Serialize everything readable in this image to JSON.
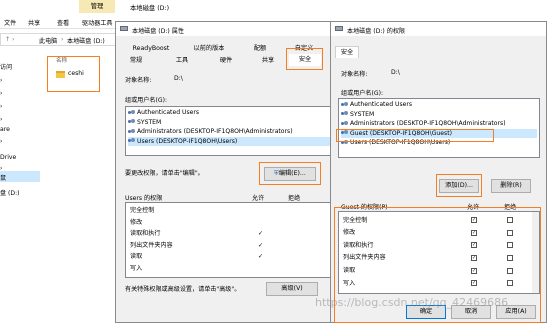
{
  "explorer": {
    "tab_manage": "管理",
    "title": "本地磁盘 (D:)",
    "menu": [
      "文件",
      "共享",
      "查看",
      "驱动器工具"
    ],
    "breadcrumb": [
      "此电脑",
      "本地磁盘 (D:)"
    ],
    "side_items": [
      "访问",
      "",
      "",
      "",
      "",
      "",
      "",
      "",
      "are",
      "",
      "Drive",
      "",
      "鼠",
      "盘 (D:)"
    ],
    "folder_header": "名称",
    "folder_name": "ceshi"
  },
  "props": {
    "title": "本地磁盘 (D:) 属性",
    "tabs_row1": [
      "ReadyBoost",
      "以前的版本",
      "配额",
      "自定义"
    ],
    "tabs_row2": [
      "常规",
      "工具",
      "硬件",
      "共享",
      "安全"
    ],
    "object_label": "对象名称:",
    "object_value": "D:\\",
    "group_label": "组或用户名(G):",
    "users": [
      "Authenticated Users",
      "SYSTEM",
      "Administrators (DESKTOP-IF1Q8OH\\Administrators)",
      "Users (DESKTOP-IF1Q8OH\\Users)"
    ],
    "change_hint": "要更改权限，请单击\"编辑\"。",
    "edit_button": "编辑(E)...",
    "perm_header": "Users 的权限",
    "allow": "允许",
    "deny": "拒绝",
    "perms": [
      "完全控制",
      "修改",
      "读取和执行",
      "列出文件夹内容",
      "读取",
      "写入"
    ],
    "allow_checks": [
      "",
      "",
      "✓",
      "✓",
      "✓",
      ""
    ],
    "adv_hint": "有关特殊权限或高级设置，请单击\"高级\"。",
    "adv_button": "高级(V)"
  },
  "perm": {
    "title": "本地磁盘 (D:) 的权限",
    "tab_security": "安全",
    "object_label": "对象名称:",
    "object_value": "D:\\",
    "group_label": "组或用户名(G):",
    "users": [
      "Authenticated Users",
      "SYSTEM",
      "Administrators (DESKTOP-IF1Q8OH\\Administrators)",
      "Guest (DESKTOP-IF1Q8OH\\Guest)",
      "Users (DESKTOP-IF1Q8OH\\Users)"
    ],
    "add_button": "添加(D)...",
    "remove_button": "删除(R)",
    "perm_header": "Guest 的权限(P)",
    "allow": "允许",
    "deny": "拒绝",
    "perms": [
      "完全控制",
      "修改",
      "读取和执行",
      "列出文件夹内容",
      "读取",
      "写入"
    ],
    "allow_checks": [
      "✓",
      "✓",
      "✓",
      "✓",
      "✓",
      "✓"
    ],
    "ok_button": "确定",
    "cancel_button": "取消",
    "apply_button": "应用(A)",
    "watermark": "https://blog.csdn.net/qq_42469686"
  }
}
